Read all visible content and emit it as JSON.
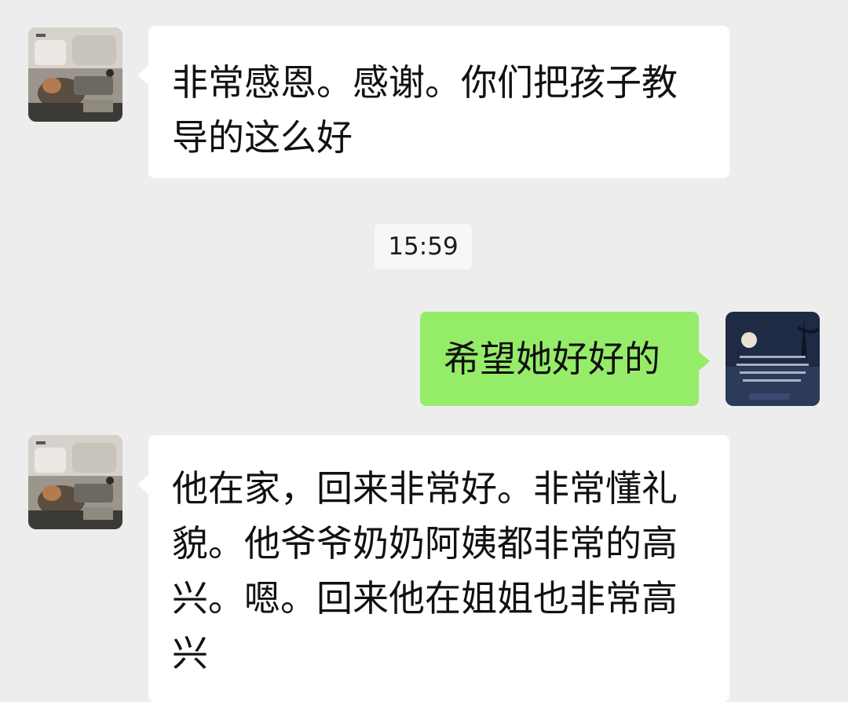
{
  "conversation": {
    "messages": [
      {
        "sender": "contact",
        "text": "非常感恩。感谢。你们把孩子教导的这么好"
      },
      {
        "sender": "me",
        "text": "希望她好好的"
      },
      {
        "sender": "contact",
        "text": "他在家，回来非常好。非常懂礼貌。他爷爷奶奶阿姨都非常的高兴。嗯。回来他在姐姐也非常高兴"
      }
    ],
    "timestamp": "15:59"
  },
  "colors": {
    "background": "#ededed",
    "incoming_bubble": "#ffffff",
    "outgoing_bubble": "#95ec69",
    "text": "#111111"
  }
}
